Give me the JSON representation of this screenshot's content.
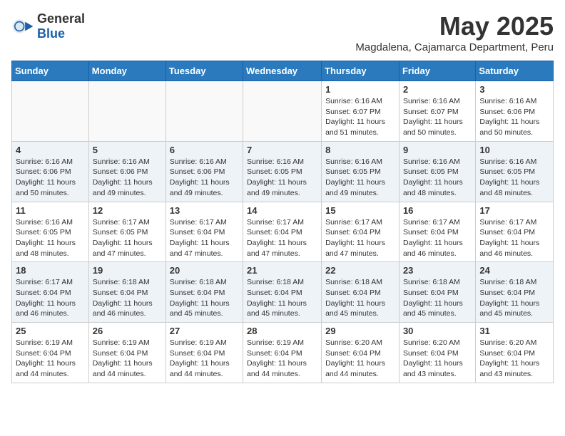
{
  "header": {
    "logo_general": "General",
    "logo_blue": "Blue",
    "month_title": "May 2025",
    "location": "Magdalena, Cajamarca Department, Peru"
  },
  "weekdays": [
    "Sunday",
    "Monday",
    "Tuesday",
    "Wednesday",
    "Thursday",
    "Friday",
    "Saturday"
  ],
  "weeks": [
    [
      {
        "day": "",
        "info": ""
      },
      {
        "day": "",
        "info": ""
      },
      {
        "day": "",
        "info": ""
      },
      {
        "day": "",
        "info": ""
      },
      {
        "day": "1",
        "info": "Sunrise: 6:16 AM\nSunset: 6:07 PM\nDaylight: 11 hours\nand 51 minutes."
      },
      {
        "day": "2",
        "info": "Sunrise: 6:16 AM\nSunset: 6:07 PM\nDaylight: 11 hours\nand 50 minutes."
      },
      {
        "day": "3",
        "info": "Sunrise: 6:16 AM\nSunset: 6:06 PM\nDaylight: 11 hours\nand 50 minutes."
      }
    ],
    [
      {
        "day": "4",
        "info": "Sunrise: 6:16 AM\nSunset: 6:06 PM\nDaylight: 11 hours\nand 50 minutes."
      },
      {
        "day": "5",
        "info": "Sunrise: 6:16 AM\nSunset: 6:06 PM\nDaylight: 11 hours\nand 49 minutes."
      },
      {
        "day": "6",
        "info": "Sunrise: 6:16 AM\nSunset: 6:06 PM\nDaylight: 11 hours\nand 49 minutes."
      },
      {
        "day": "7",
        "info": "Sunrise: 6:16 AM\nSunset: 6:05 PM\nDaylight: 11 hours\nand 49 minutes."
      },
      {
        "day": "8",
        "info": "Sunrise: 6:16 AM\nSunset: 6:05 PM\nDaylight: 11 hours\nand 49 minutes."
      },
      {
        "day": "9",
        "info": "Sunrise: 6:16 AM\nSunset: 6:05 PM\nDaylight: 11 hours\nand 48 minutes."
      },
      {
        "day": "10",
        "info": "Sunrise: 6:16 AM\nSunset: 6:05 PM\nDaylight: 11 hours\nand 48 minutes."
      }
    ],
    [
      {
        "day": "11",
        "info": "Sunrise: 6:16 AM\nSunset: 6:05 PM\nDaylight: 11 hours\nand 48 minutes."
      },
      {
        "day": "12",
        "info": "Sunrise: 6:17 AM\nSunset: 6:05 PM\nDaylight: 11 hours\nand 47 minutes."
      },
      {
        "day": "13",
        "info": "Sunrise: 6:17 AM\nSunset: 6:04 PM\nDaylight: 11 hours\nand 47 minutes."
      },
      {
        "day": "14",
        "info": "Sunrise: 6:17 AM\nSunset: 6:04 PM\nDaylight: 11 hours\nand 47 minutes."
      },
      {
        "day": "15",
        "info": "Sunrise: 6:17 AM\nSunset: 6:04 PM\nDaylight: 11 hours\nand 47 minutes."
      },
      {
        "day": "16",
        "info": "Sunrise: 6:17 AM\nSunset: 6:04 PM\nDaylight: 11 hours\nand 46 minutes."
      },
      {
        "day": "17",
        "info": "Sunrise: 6:17 AM\nSunset: 6:04 PM\nDaylight: 11 hours\nand 46 minutes."
      }
    ],
    [
      {
        "day": "18",
        "info": "Sunrise: 6:17 AM\nSunset: 6:04 PM\nDaylight: 11 hours\nand 46 minutes."
      },
      {
        "day": "19",
        "info": "Sunrise: 6:18 AM\nSunset: 6:04 PM\nDaylight: 11 hours\nand 46 minutes."
      },
      {
        "day": "20",
        "info": "Sunrise: 6:18 AM\nSunset: 6:04 PM\nDaylight: 11 hours\nand 45 minutes."
      },
      {
        "day": "21",
        "info": "Sunrise: 6:18 AM\nSunset: 6:04 PM\nDaylight: 11 hours\nand 45 minutes."
      },
      {
        "day": "22",
        "info": "Sunrise: 6:18 AM\nSunset: 6:04 PM\nDaylight: 11 hours\nand 45 minutes."
      },
      {
        "day": "23",
        "info": "Sunrise: 6:18 AM\nSunset: 6:04 PM\nDaylight: 11 hours\nand 45 minutes."
      },
      {
        "day": "24",
        "info": "Sunrise: 6:18 AM\nSunset: 6:04 PM\nDaylight: 11 hours\nand 45 minutes."
      }
    ],
    [
      {
        "day": "25",
        "info": "Sunrise: 6:19 AM\nSunset: 6:04 PM\nDaylight: 11 hours\nand 44 minutes."
      },
      {
        "day": "26",
        "info": "Sunrise: 6:19 AM\nSunset: 6:04 PM\nDaylight: 11 hours\nand 44 minutes."
      },
      {
        "day": "27",
        "info": "Sunrise: 6:19 AM\nSunset: 6:04 PM\nDaylight: 11 hours\nand 44 minutes."
      },
      {
        "day": "28",
        "info": "Sunrise: 6:19 AM\nSunset: 6:04 PM\nDaylight: 11 hours\nand 44 minutes."
      },
      {
        "day": "29",
        "info": "Sunrise: 6:20 AM\nSunset: 6:04 PM\nDaylight: 11 hours\nand 44 minutes."
      },
      {
        "day": "30",
        "info": "Sunrise: 6:20 AM\nSunset: 6:04 PM\nDaylight: 11 hours\nand 43 minutes."
      },
      {
        "day": "31",
        "info": "Sunrise: 6:20 AM\nSunset: 6:04 PM\nDaylight: 11 hours\nand 43 minutes."
      }
    ]
  ]
}
